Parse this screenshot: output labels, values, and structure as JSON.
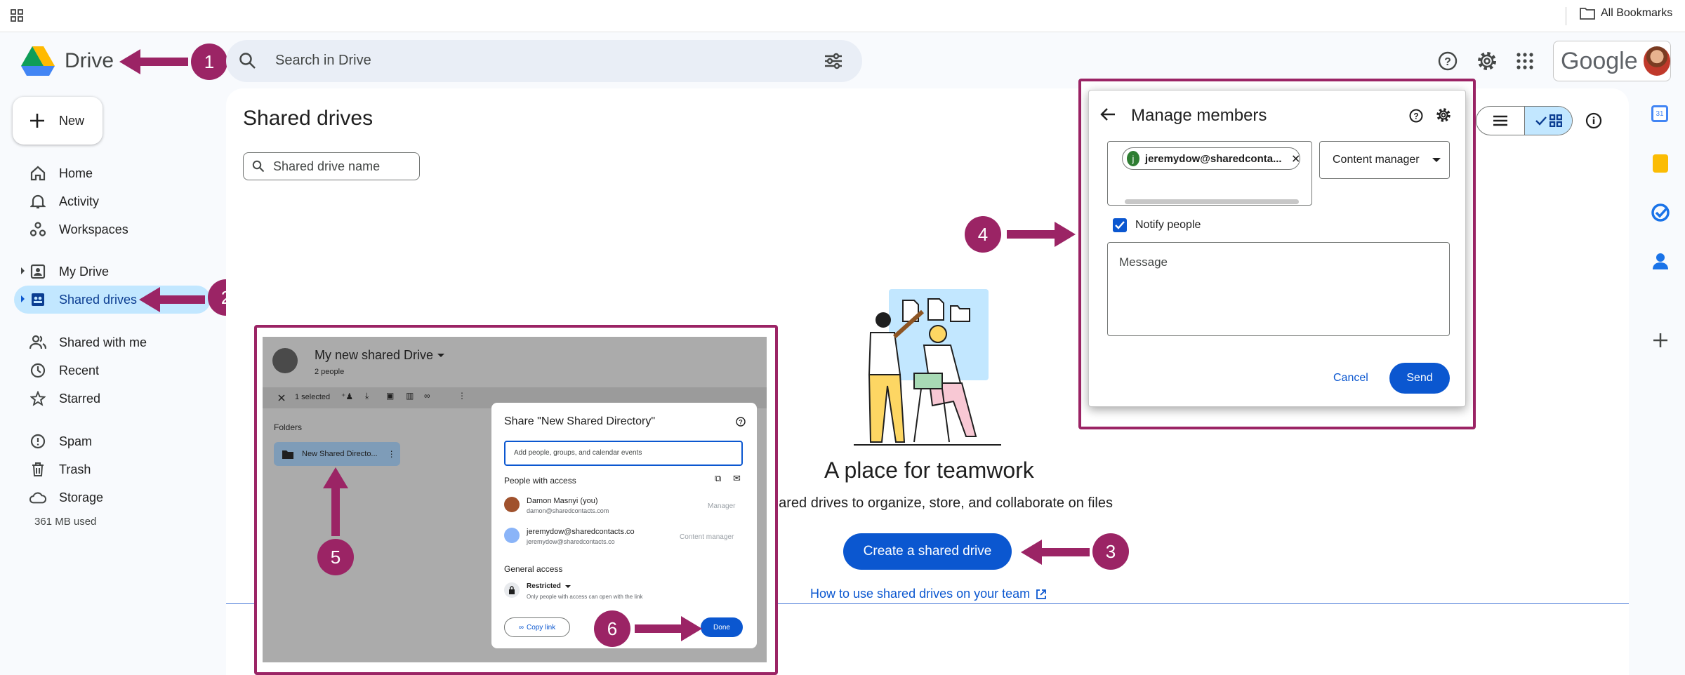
{
  "bookmarks": {
    "label": "All Bookmarks"
  },
  "header": {
    "app_name": "Drive",
    "search_placeholder": "Search in Drive",
    "google_label": "Google"
  },
  "sidebar": {
    "new_label": "New",
    "items": [
      {
        "label": "Home"
      },
      {
        "label": "Activity"
      },
      {
        "label": "Workspaces"
      },
      {
        "label": "My Drive"
      },
      {
        "label": "Shared drives"
      },
      {
        "label": "Shared with me"
      },
      {
        "label": "Recent"
      },
      {
        "label": "Starred"
      },
      {
        "label": "Spam"
      },
      {
        "label": "Trash"
      },
      {
        "label": "Storage"
      }
    ],
    "storage_used": "361 MB used"
  },
  "main": {
    "title": "Shared drives",
    "filter_placeholder": "Shared drive name",
    "empty_title": "A place for teamwork",
    "empty_desc": "shared drives to organize, store, and collaborate on files",
    "create_button": "Create a shared drive",
    "help_link": "How to use shared drives on your team"
  },
  "manage_members": {
    "title": "Manage members",
    "chip_initial": "j",
    "chip_email": "jeremydow@sharedconta...",
    "role": "Content manager",
    "notify_label": "Notify people",
    "message_placeholder": "Message",
    "cancel": "Cancel",
    "send": "Send"
  },
  "inset": {
    "drive_name": "My new shared Drive",
    "people_count": "2 people",
    "selected": "1 selected",
    "folders_label": "Folders",
    "folder_name": "New Shared Directo...",
    "share_title": "Share \"New Shared Directory\"",
    "share_input_placeholder": "Add people, groups, and calendar events",
    "people_with_access": "People with access",
    "person1_name": "Damon Masnyi (you)",
    "person1_email": "damon@sharedcontacts.com",
    "person1_role": "Manager",
    "person2_name": "jeremydow@sharedcontacts.co",
    "person2_email": "jeremydow@sharedcontacts.co",
    "person2_role": "Content manager",
    "general_access": "General access",
    "access_level": "Restricted",
    "access_desc": "Only people with access can open with the link",
    "copy_link": "Copy link",
    "done": "Done"
  },
  "annotations": {
    "step1": "1",
    "step2": "2",
    "step3": "3",
    "step4": "4",
    "step5": "5",
    "step6": "6",
    "accent_color": "#9b2465"
  }
}
